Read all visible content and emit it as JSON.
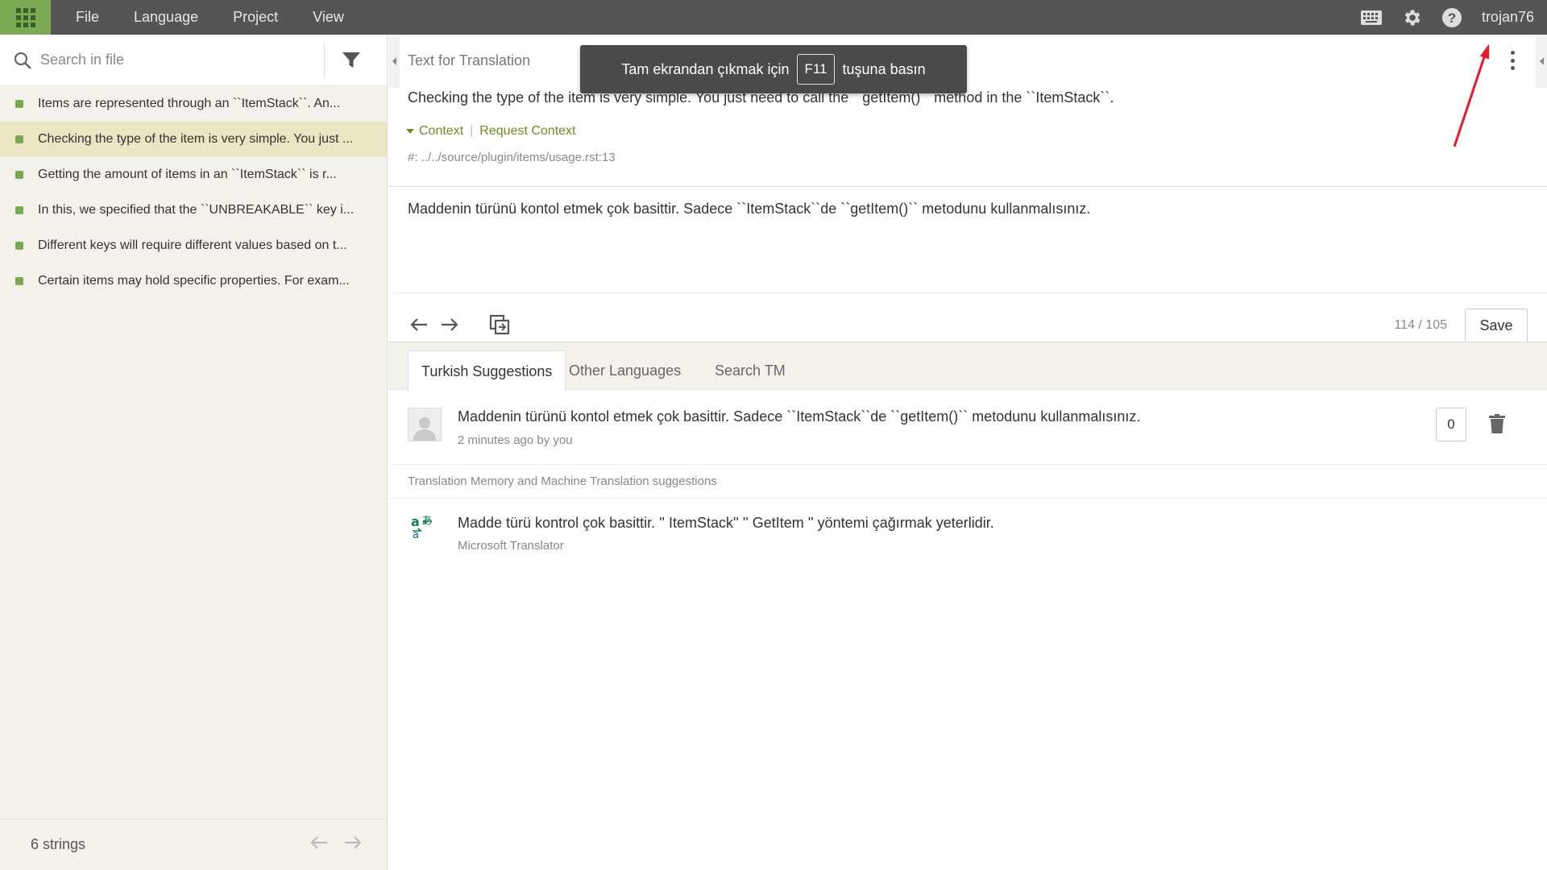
{
  "topbar": {
    "menu": [
      "File",
      "Language",
      "Project",
      "View"
    ],
    "username": "trojan76"
  },
  "left": {
    "search_placeholder": "Search in file",
    "strings": [
      {
        "text": "Items are represented through an ``ItemStack``. An...",
        "active": false
      },
      {
        "text": "Checking the type of the item is very simple. You just ...",
        "active": true
      },
      {
        "text": "Getting the amount of items in an ``ItemStack`` is r...",
        "active": false
      },
      {
        "text": "In this, we specified that the ``UNBREAKABLE`` key i...",
        "active": false
      },
      {
        "text": "Different keys will require different values based on t...",
        "active": false
      },
      {
        "text": "Certain items may hold specific properties. For exam...",
        "active": false
      }
    ],
    "count": "6 strings"
  },
  "source": {
    "title": "Text for Translation",
    "text": "Checking the type of the item is very simple. You just need to call the ``getItem()`` method in the ``ItemStack``.",
    "context_label": "Context",
    "request_context_label": "Request Context",
    "location": "#: ../../source/plugin/items/usage.rst:13"
  },
  "translation": {
    "text": "Maddenin türünü kontol etmek çok basittir. Sadece ``ItemStack``de ``getItem()`` metodunu kullanmalısınız."
  },
  "editor": {
    "counter": "114 / 105",
    "save_label": "Save"
  },
  "tabs": [
    "Turkish Suggestions",
    "Other Languages",
    "Search TM"
  ],
  "suggestion": {
    "text": "Maddenin türünü kontol etmek çok basittir. Sadece ``ItemStack``de ``getItem()`` metodunu kullanmalısınız.",
    "meta": "2 minutes ago by you",
    "votes": "0"
  },
  "tm": {
    "header": "Translation Memory and Machine Translation suggestions",
    "text": "Madde türü kontrol çok basittir. '' ItemStack'' '' GetItem '' yöntemi çağırmak yeterlidir.",
    "source": "Microsoft Translator"
  },
  "toast": {
    "before": "Tam ekrandan çıkmak için",
    "key": "F11",
    "after": "tuşuna basın"
  },
  "colors": {
    "accent": "#7aa853",
    "topbar": "#555555",
    "context": "#6d8c22",
    "active_row": "#ece5c4",
    "annotation": "#e8192c"
  }
}
